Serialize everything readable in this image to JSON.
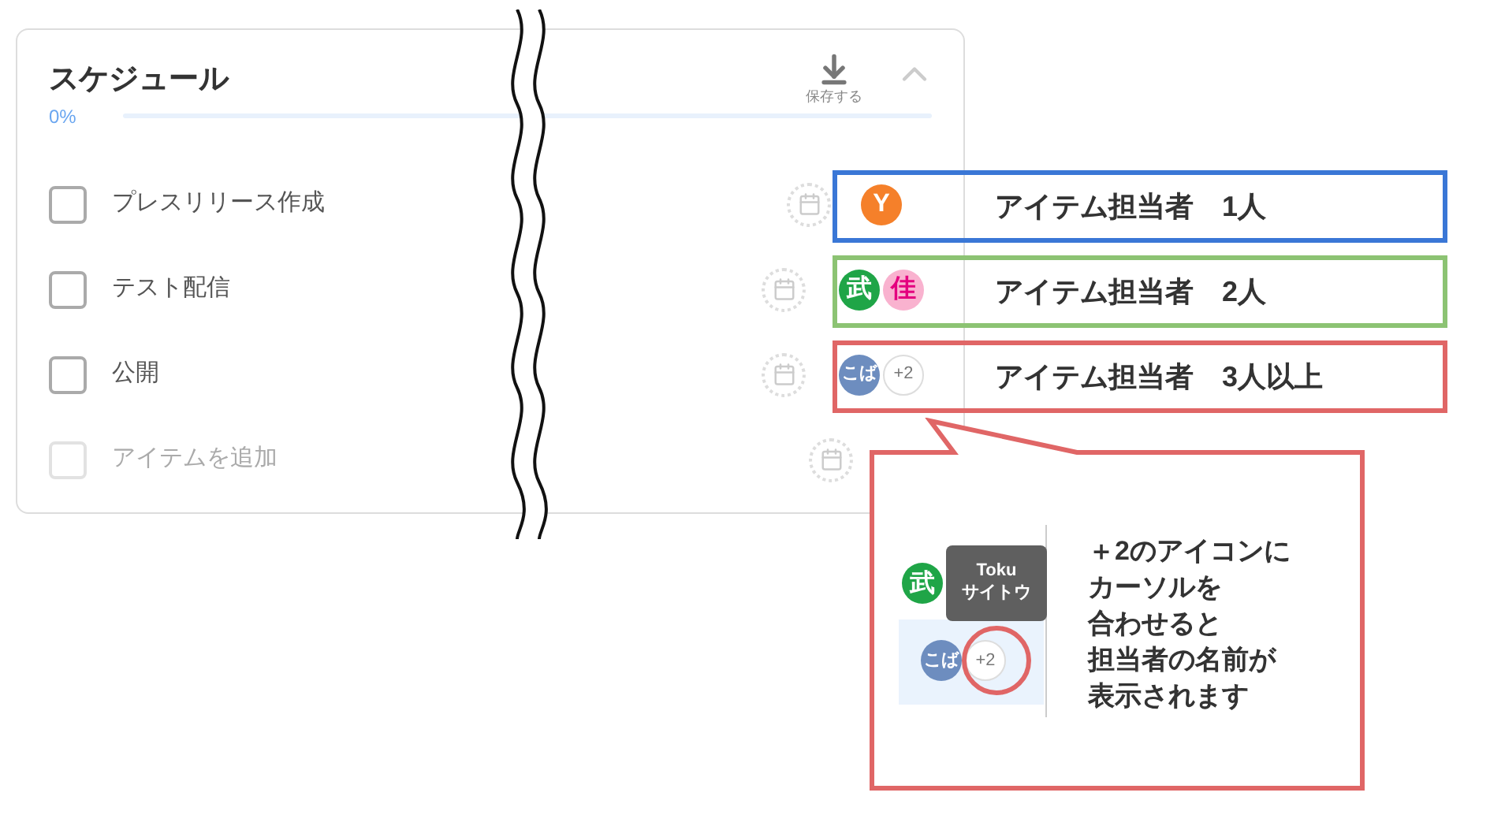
{
  "card": {
    "title": "スケジュール",
    "save_label": "保存する",
    "progress": {
      "label": "0%",
      "level": 0
    },
    "items": [
      {
        "label": "プレスリリース作成",
        "checked": false,
        "assignees": [
          {
            "kind": "solid",
            "text": "Y",
            "color": "#f5802a"
          }
        ]
      },
      {
        "label": "テスト配信",
        "checked": false,
        "assignees": [
          {
            "kind": "solid",
            "text": "武",
            "color": "#1fa547"
          },
          {
            "kind": "tint",
            "text": "佳",
            "color": "#f9b2cf"
          }
        ]
      },
      {
        "label": "公開",
        "checked": false,
        "assignees": [
          {
            "kind": "solid",
            "text": "こば",
            "color": "#6d8dbf"
          },
          {
            "kind": "more",
            "text": "+2",
            "color": "#ffffff"
          }
        ]
      }
    ],
    "add_item": {
      "placeholder": "アイテムを追加",
      "disabled": true
    }
  },
  "annotations": [
    {
      "text": "アイテム担当者　1人",
      "color": "#3a77d6"
    },
    {
      "text": "アイテム担当者　2人",
      "color": "#8cc373"
    },
    {
      "text": "アイテム担当者　3人以上",
      "color": "#e06666"
    }
  ],
  "callout": {
    "lines": [
      "＋2のアイコンに",
      "カーソルを",
      "合わせると",
      "担当者の名前が",
      "表示されます"
    ],
    "inset": {
      "tooltip": [
        "Toku",
        "サイトウ"
      ],
      "avatars_top": [
        {
          "kind": "solid",
          "text": "武",
          "color": "#1fa547"
        }
      ],
      "avatars_bottom": [
        {
          "kind": "solid",
          "text": "こば",
          "color": "#6d8dbf"
        },
        {
          "kind": "more",
          "text": "+2",
          "color": "#ffffff"
        }
      ]
    }
  }
}
